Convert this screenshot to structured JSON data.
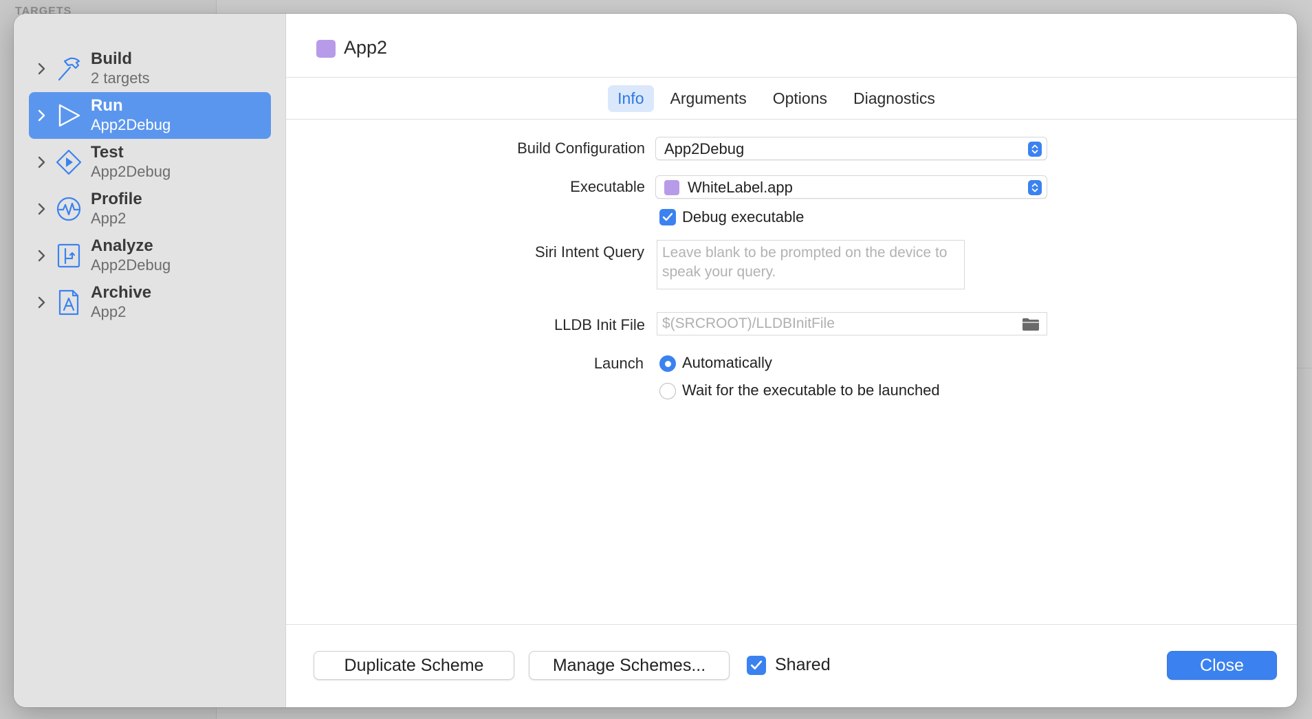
{
  "backdrop": {
    "section_label": "TARGETS"
  },
  "sidebar": {
    "items": [
      {
        "title": "Build",
        "subtitle": "2 targets",
        "icon": "hammer-icon"
      },
      {
        "title": "Run",
        "subtitle": "App2Debug",
        "icon": "play-icon"
      },
      {
        "title": "Test",
        "subtitle": "App2Debug",
        "icon": "test-diamond-icon"
      },
      {
        "title": "Profile",
        "subtitle": "App2",
        "icon": "pulse-icon"
      },
      {
        "title": "Analyze",
        "subtitle": "App2Debug",
        "icon": "analyze-icon"
      },
      {
        "title": "Archive",
        "subtitle": "App2",
        "icon": "archive-icon"
      }
    ],
    "selected_index": 1
  },
  "scheme": {
    "name": "App2",
    "swatch_color": "#b79be8"
  },
  "tabs": [
    "Info",
    "Arguments",
    "Options",
    "Diagnostics"
  ],
  "active_tab": "Info",
  "form": {
    "build_configuration_label": "Build Configuration",
    "build_configuration_value": "App2Debug",
    "executable_label": "Executable",
    "executable_value": "WhiteLabel.app",
    "debug_executable_label": "Debug executable",
    "debug_executable_checked": true,
    "siri_label": "Siri Intent Query",
    "siri_placeholder": "Leave blank to be prompted on the device to speak your query.",
    "lldb_label": "LLDB Init File",
    "lldb_placeholder": "$(SRCROOT)/LLDBInitFile",
    "launch_label": "Launch",
    "launch_options": [
      "Automatically",
      "Wait for the executable to be launched"
    ],
    "launch_selected": "Automatically"
  },
  "footer": {
    "duplicate_label": "Duplicate Scheme",
    "manage_label": "Manage Schemes...",
    "shared_label": "Shared",
    "shared_checked": true,
    "close_label": "Close"
  },
  "colors": {
    "accent": "#3b82f0",
    "selection": "#5b96ee",
    "sidebar_bg": "#e3e3e3"
  }
}
